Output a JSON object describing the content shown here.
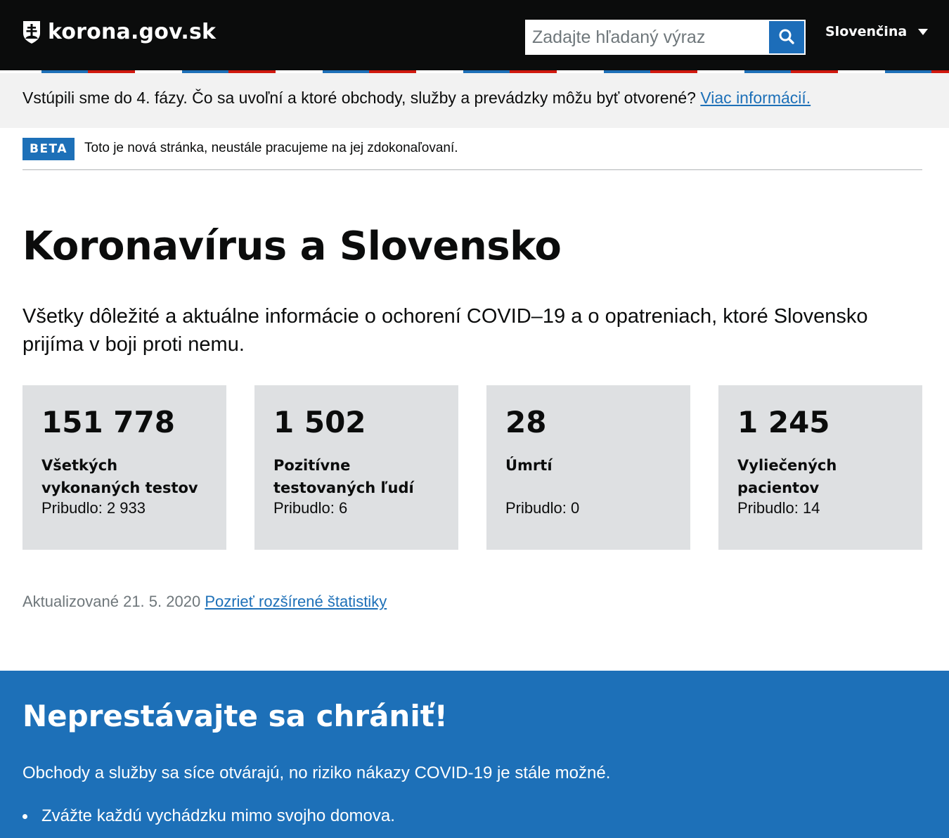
{
  "header": {
    "site_name": "korona.gov.sk",
    "search": {
      "placeholder": "Zadajte hľadaný výraz",
      "value": ""
    },
    "language": "Slovenčina"
  },
  "phase_banner": {
    "text": "Vstúpili sme do 4. fázy. Čo sa uvoľní a ktoré obchody, služby a prevádzky môžu byť otvorené?",
    "link": "Viac informácií."
  },
  "beta": {
    "tag": "BETA",
    "text": "Toto je nová stránka, neustále pracujeme na jej zdokonaľovaní."
  },
  "main": {
    "title": "Koronavírus a Slovensko",
    "lead": "Všetky dôležité a aktuálne informácie o ochorení COVID–19 a o opatreniach, ktoré Slovensko prijíma v boji proti nemu.",
    "stats": [
      {
        "value": "151 778",
        "label": "Všetkých vykonaných testov",
        "delta": "Pribudlo: 2 933"
      },
      {
        "value": "1 502",
        "label": "Pozitívne testovaných ľudí",
        "delta": "Pribudlo: 6"
      },
      {
        "value": "28",
        "label": "Úmrtí",
        "delta": "Pribudlo: 0"
      },
      {
        "value": "1 245",
        "label": "Vyliečených pacientov",
        "delta": "Pribudlo: 14"
      }
    ],
    "updated": "Aktualizované 21. 5. 2020",
    "stats_link": "Pozrieť rozšírené štatistiky"
  },
  "protect": {
    "title": "Neprestávajte sa chrániť!",
    "text": "Obchody a služby sa síce otvárajú, no riziko nákazy COVID-19 je stále možné.",
    "items": [
      "Zvážte každú vychádzku mimo svojho domova."
    ]
  },
  "colors": {
    "header_bg": "#0b0c0c",
    "accent_blue": "#1d70b8",
    "flag_red": "#d0190f",
    "stat_bg": "#dee0e2",
    "banner_bg": "#f2f2f2"
  },
  "icons": {
    "logo": "slovak-coat-of-arms-icon",
    "search": "search-icon",
    "language": "chevron-down-icon"
  }
}
